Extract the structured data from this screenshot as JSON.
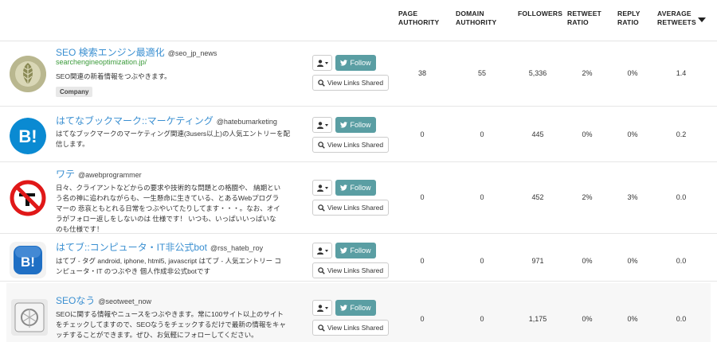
{
  "columns": {
    "page_authority": [
      "PAGE",
      "AUTHORITY"
    ],
    "domain_authority": [
      "DOMAIN",
      "AUTHORITY"
    ],
    "followers": [
      "FOLLOWERS"
    ],
    "retweet_ratio": [
      "RETWEET",
      "RATIO"
    ],
    "reply_ratio": [
      "REPLY",
      "RATIO"
    ],
    "average_retweets": [
      "AVERAGE",
      "RETWEETS"
    ]
  },
  "buttons": {
    "follow": "Follow",
    "view_links": "View Links Shared"
  },
  "rows": [
    {
      "name": "SEO 検索エンジン最適化",
      "handle": "@seo_jp_news",
      "site": "searchengineoptimization.jp/",
      "desc": "SEO関連の新着情報をつぶやきます。",
      "tag": "Company",
      "page_authority": "38",
      "domain_authority": "55",
      "followers": "5,336",
      "retweet_ratio": "2%",
      "reply_ratio": "0%",
      "average_retweets": "1.4"
    },
    {
      "name": "はてなブックマーク::マーケティング",
      "handle": "@hatebumarketing",
      "desc": "はてなブックマークのマーケティング関連(3users以上)の人気エントリーを配信します。",
      "page_authority": "0",
      "domain_authority": "0",
      "followers": "445",
      "retweet_ratio": "0%",
      "reply_ratio": "0%",
      "average_retweets": "0.2"
    },
    {
      "name": "ワテ",
      "handle": "@awebprogrammer",
      "desc": "日々、クライアントなどからの要求や技術的な問題との格闘や、 納期という名の神に追われながらも、一生懸命に生きている、とあるWebプログラマーの 悲哀ともとれる日常をつぶやいてたりしてます・・・。なお、オイラがフォロー返しをしないのは 仕様です！ いつも、いっぱいいっぱいなのも仕様です！",
      "page_authority": "0",
      "domain_authority": "0",
      "followers": "452",
      "retweet_ratio": "2%",
      "reply_ratio": "3%",
      "average_retweets": "0.0"
    },
    {
      "name": "はてブ::コンピュータ・IT非公式bot",
      "handle": "@rss_hateb_roy",
      "desc": "はてブ - タグ android, iphone, html5, javascript はてブ - 人気エントリー コンピュータ・IT のつぶやき 個人作成非公式botです",
      "page_authority": "0",
      "domain_authority": "0",
      "followers": "971",
      "retweet_ratio": "0%",
      "reply_ratio": "0%",
      "average_retweets": "0.0"
    },
    {
      "name": "SEOなう",
      "handle": "@seotweet_now",
      "desc": "SEOに関する情報やニュースをつぶやきます。常に100サイト以上のサイトをチェックしてますので、SEOなうをチェックするだけで最新の情報をキャッチすることができます。ぜひ、お気軽にフォローしてください。",
      "page_authority": "0",
      "domain_authority": "0",
      "followers": "1,175",
      "retweet_ratio": "0%",
      "reply_ratio": "0%",
      "average_retweets": "0.0"
    }
  ],
  "colors": {
    "link": "#3a8fd1",
    "site": "#3a9a3a",
    "follow_bg": "#5a9ea3",
    "row_alt": "#f7f7f7"
  },
  "icons": {
    "user_menu": "user-icon",
    "follow": "twitter-icon",
    "links": "search-icon",
    "sort": "caret-down-icon"
  }
}
